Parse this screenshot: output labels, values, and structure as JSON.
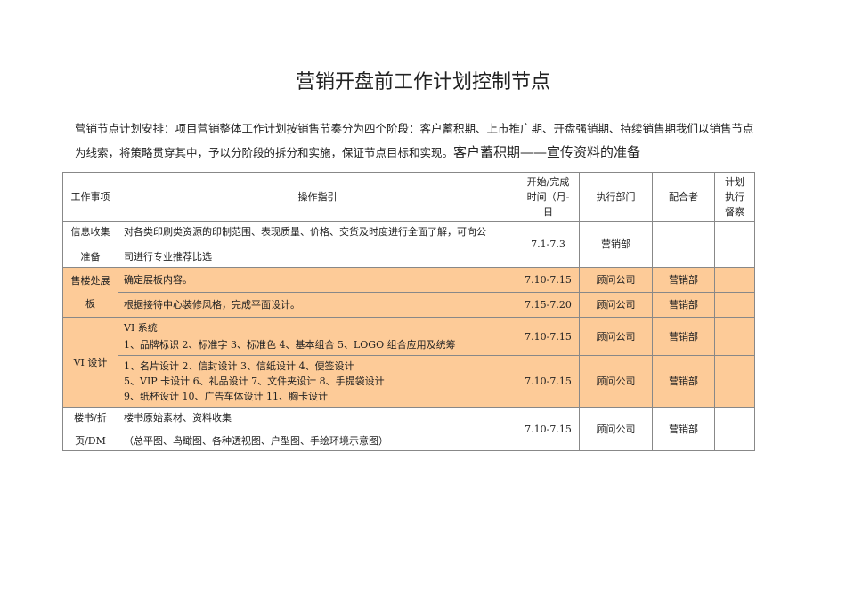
{
  "title": "营销开盘前工作计划控制节点",
  "intro": {
    "text": "营销节点计划安排：项目营销整体工作计划按销售节奏分为四个阶段：客户蓄积期、上市推广期、开盘强销期、持续销售期我们以销售节点为线索，将策略贯穿其中，予以分阶段的拆分和实施，保证节点目标和实现。",
    "heading": "客户蓄积期——宣传资料的准备"
  },
  "table": {
    "headers": [
      "工作事项",
      "操作指引",
      "开始/完成时间（月-日",
      "执行部门",
      "配合者",
      "计划执行督察"
    ],
    "rows": [
      {
        "item": "信息收集\n\n准备",
        "guide": "对各类印刷类资源的印制范围、表现质量、价格、交货及时度进行全面了解，可向公\n\n司进行专业推荐比选",
        "time": "7.1-7.3",
        "dept": "营销部",
        "partner": "",
        "supervise": ""
      },
      {
        "item": "售楼处展\n\n板",
        "guide": "确定展板内容。",
        "time": "7.10-7.15",
        "dept": "顾问公司",
        "partner": "营销部",
        "supervise": ""
      },
      {
        "guide": "根据接待中心装修风格，完成平面设计。",
        "time": "7.15-7.20",
        "dept": "顾问公司",
        "partner": "营销部",
        "supervise": ""
      },
      {
        "item": "VI 设计",
        "guide": "VI 系统\n1、品牌标识 2、标准字 3、标准色 4、基本组合 5、LOGO 组合应用及统筹",
        "time": "7.10-7.15",
        "dept": "顾问公司",
        "partner": "营销部",
        "supervise": ""
      },
      {
        "guide": "1、名片设计 2、信封设计 3、信纸设计 4、便签设计\n5、VIP 卡设计 6、礼品设计 7、文件夹设计 8、手提袋设计\n9、纸杯设计 10、广告车体设计 11、胸卡设计",
        "time": "7.10-7.15",
        "dept": "顾问公司",
        "partner": "营销部",
        "supervise": ""
      },
      {
        "item": "楼书/折\n\n页/DM",
        "guide": "楼书原始素材、资料收集\n\n （总平图、鸟瞰图、各种透视图、户型图、手绘环境示意图）",
        "time": "7.10-7.15",
        "dept": "顾问公司",
        "partner": "营销部",
        "supervise": ""
      }
    ]
  }
}
